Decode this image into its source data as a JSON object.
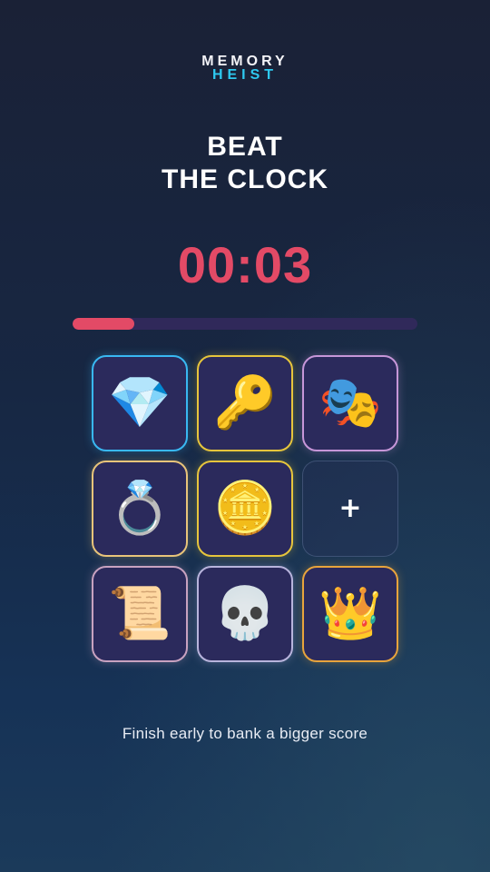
{
  "logo": {
    "line1": "MEMORY",
    "line2": "HEIST"
  },
  "title": {
    "line1": "BEAT",
    "line2": "THE CLOCK"
  },
  "timer": {
    "value": "00:03"
  },
  "progress": {
    "fraction": 0.18
  },
  "tiles": [
    {
      "icon": "diamond-icon",
      "glyph": "💎",
      "border": "#39b8f2"
    },
    {
      "icon": "key-icon",
      "glyph": "🔑",
      "border": "#e6c53c"
    },
    {
      "icon": "theater-masks-icon",
      "glyph": "🎭",
      "border": "#c696d8"
    },
    {
      "icon": "ring-icon",
      "glyph": "💍",
      "border": "#e8c47a"
    },
    {
      "icon": "coin-icon",
      "glyph": "🪙",
      "border": "#e6c53c"
    },
    {
      "icon": "plus-icon",
      "glyph": "+",
      "border": "",
      "empty": true
    },
    {
      "icon": "scroll-icon",
      "glyph": "📜",
      "border": "#c8a2c0"
    },
    {
      "icon": "skull-icon",
      "glyph": "💀",
      "border": "#b8b4dc"
    },
    {
      "icon": "crown-icon",
      "glyph": "👑",
      "border": "#e8a43c"
    }
  ],
  "hint": "Finish early to bank a bigger score",
  "colors": {
    "accent": "#e34a66",
    "logo_highlight": "#2ec9f0",
    "tile_bg": "#2b2a5c",
    "track": "#30295a"
  }
}
